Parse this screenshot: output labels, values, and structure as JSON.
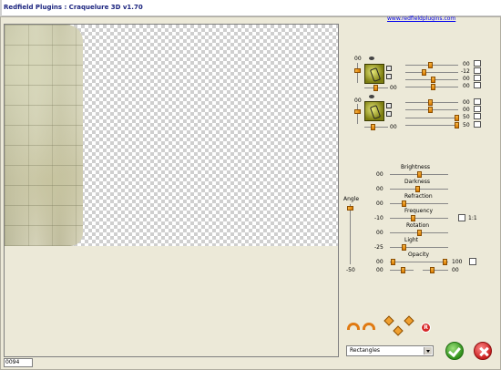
{
  "window": {
    "title": "Redfield Plugins : Craquelure 3D  v1.70"
  },
  "header": {
    "website_link": "www.redfieldplugins.com"
  },
  "status": {
    "code": "0094"
  },
  "light1": {
    "left_value": "00",
    "bottom_value": "00",
    "right_values": [
      "00",
      "-12",
      "00",
      "00"
    ]
  },
  "light2": {
    "left_value": "00",
    "bottom_value": "00",
    "right_values": [
      "00",
      "00",
      "50",
      "50"
    ]
  },
  "angle": {
    "label": "Angle",
    "value": "-50"
  },
  "adjustments": [
    {
      "label": "Brightness",
      "value": "00"
    },
    {
      "label": "Darkness",
      "value": "00"
    },
    {
      "label": "Refraction",
      "value": "00"
    },
    {
      "label": "Frequency",
      "value": "-10"
    },
    {
      "label": "Rotation",
      "value": "00"
    },
    {
      "label": "Light",
      "value": "-25"
    },
    {
      "label": "Opacity",
      "value": "00",
      "value_right": "100"
    }
  ],
  "last_row": {
    "left_value": "00",
    "right_value": "00"
  },
  "ratio": {
    "label": "1:1"
  },
  "pattern_select": {
    "selected": "Rectangles"
  }
}
